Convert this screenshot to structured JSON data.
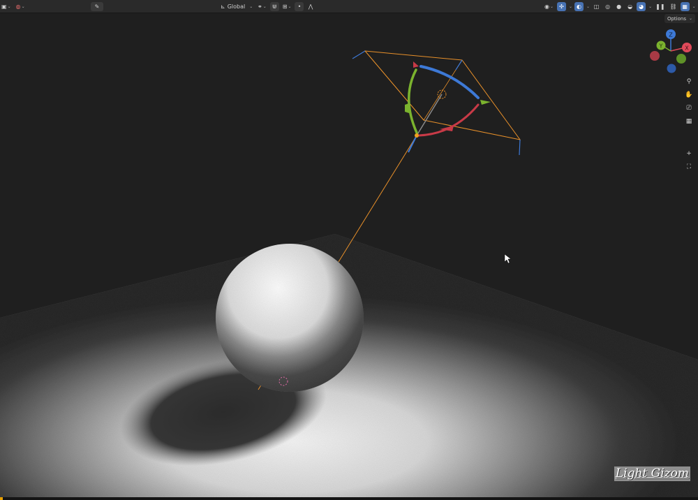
{
  "header": {
    "orientation_label": "Global",
    "options_label": "Options"
  },
  "overlay": {
    "caption": "Light Gizom"
  },
  "icons": {
    "editor_type": "cube-icon",
    "object_mode": "sphere-icon",
    "eyedropper": "eyedropper-icon",
    "orientation": "axes-icon",
    "pivot": "pivot-icon",
    "snap": "magnet-icon",
    "proportional": "proportional-icon",
    "visibility": "eye-icon",
    "gizmos": "gizmo-icon",
    "overlays": "overlay-icon",
    "xray": "xray-icon",
    "shading_wire": "wireframe-icon",
    "shading_solid": "solid-icon",
    "shading_material": "material-icon",
    "shading_rendered": "rendered-icon",
    "zoom": "zoom-icon",
    "pan": "hand-icon",
    "camera": "camera-icon",
    "ortho": "grid-icon",
    "add": "plus-icon",
    "frame": "frame-icon"
  },
  "colors": {
    "axis_x": "#e04a5a",
    "axis_y": "#7bb32e",
    "axis_z": "#3d79d6",
    "light_select": "#e8902a",
    "background": "#1d1d1d"
  },
  "axis_gizmo": {
    "x": "X",
    "y": "Y",
    "z": "Z"
  }
}
